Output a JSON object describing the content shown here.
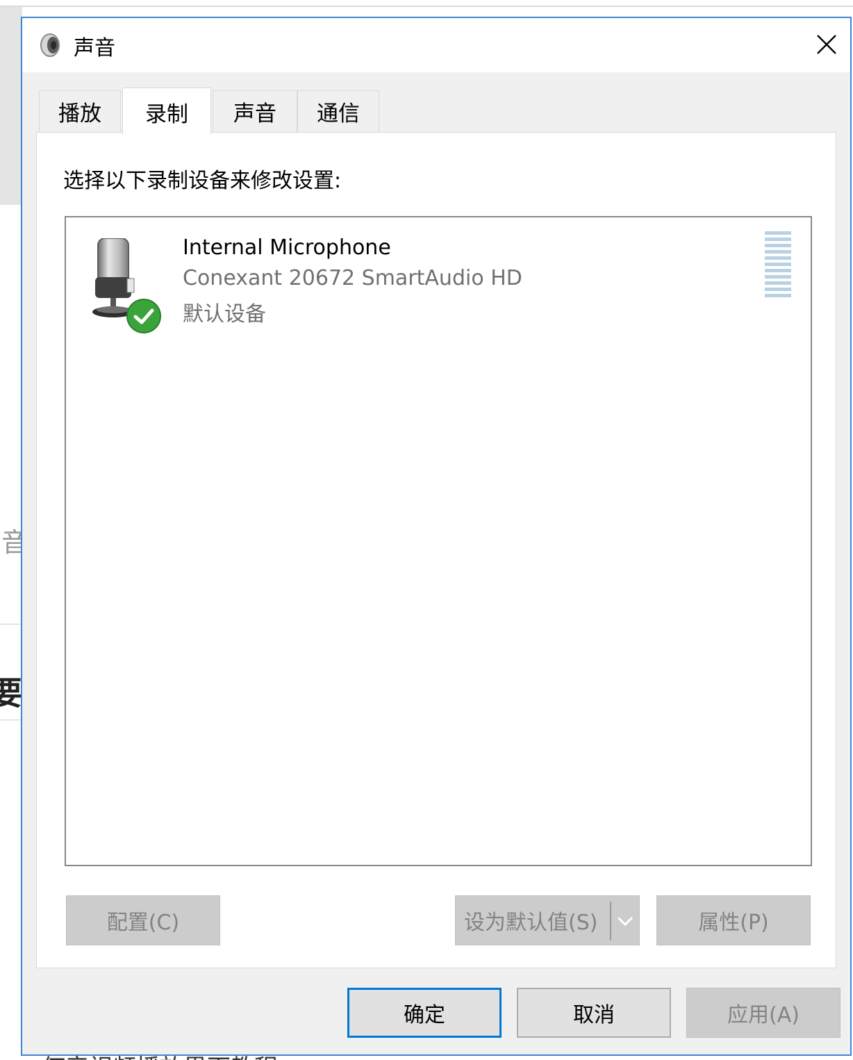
{
  "background_window": {
    "fragment_1": "音",
    "fragment_2": "的要",
    "fragment_3": "何音视频播放界面教程"
  },
  "dialog": {
    "title": "声音",
    "icons": {
      "app": "speaker-icon",
      "close": "close-icon"
    }
  },
  "tabs": [
    {
      "label": "播放",
      "active": false
    },
    {
      "label": "录制",
      "active": true
    },
    {
      "label": "声音",
      "active": false
    },
    {
      "label": "通信",
      "active": false
    }
  ],
  "recording_panel": {
    "instruction": "选择以下录制设备来修改设置:",
    "devices": [
      {
        "name": "Internal Microphone",
        "driver": "Conexant 20672 SmartAudio HD",
        "status": "默认设备",
        "icon": "microphone-icon",
        "badge": "default-checkmark-icon",
        "input_level": 0
      }
    ],
    "buttons": {
      "configure": "配置(C)",
      "set_default": "设为默认值(S)",
      "properties": "属性(P)"
    }
  },
  "footer": {
    "ok": "确定",
    "cancel": "取消",
    "apply": "应用(A)"
  },
  "colors": {
    "dialog_border": "#3b87d6",
    "primary_button_border": "#0078d7",
    "checkmark_green": "#3aa33a",
    "level_meter": "#b9d2e3"
  }
}
